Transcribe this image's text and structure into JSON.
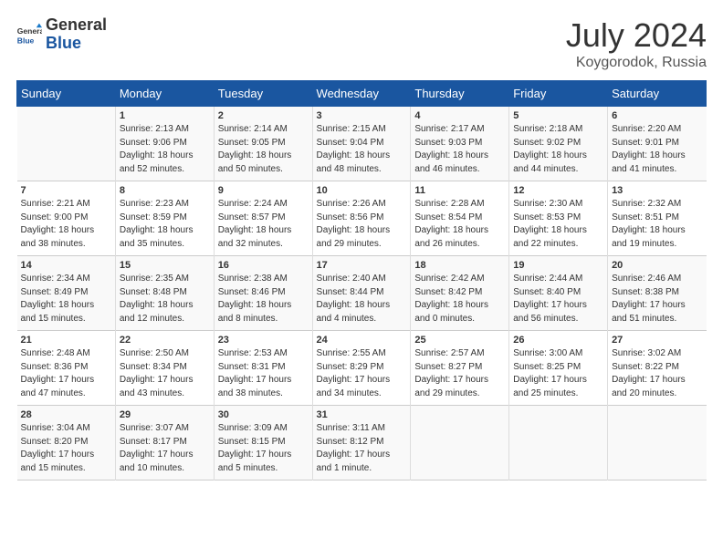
{
  "header": {
    "logo_general": "General",
    "logo_blue": "Blue",
    "month_title": "July 2024",
    "location": "Koygorodok, Russia"
  },
  "weekdays": [
    "Sunday",
    "Monday",
    "Tuesday",
    "Wednesday",
    "Thursday",
    "Friday",
    "Saturday"
  ],
  "weeks": [
    [
      {
        "day": "",
        "info": ""
      },
      {
        "day": "1",
        "info": "Sunrise: 2:13 AM\nSunset: 9:06 PM\nDaylight: 18 hours\nand 52 minutes."
      },
      {
        "day": "2",
        "info": "Sunrise: 2:14 AM\nSunset: 9:05 PM\nDaylight: 18 hours\nand 50 minutes."
      },
      {
        "day": "3",
        "info": "Sunrise: 2:15 AM\nSunset: 9:04 PM\nDaylight: 18 hours\nand 48 minutes."
      },
      {
        "day": "4",
        "info": "Sunrise: 2:17 AM\nSunset: 9:03 PM\nDaylight: 18 hours\nand 46 minutes."
      },
      {
        "day": "5",
        "info": "Sunrise: 2:18 AM\nSunset: 9:02 PM\nDaylight: 18 hours\nand 44 minutes."
      },
      {
        "day": "6",
        "info": "Sunrise: 2:20 AM\nSunset: 9:01 PM\nDaylight: 18 hours\nand 41 minutes."
      }
    ],
    [
      {
        "day": "7",
        "info": "Sunrise: 2:21 AM\nSunset: 9:00 PM\nDaylight: 18 hours\nand 38 minutes."
      },
      {
        "day": "8",
        "info": "Sunrise: 2:23 AM\nSunset: 8:59 PM\nDaylight: 18 hours\nand 35 minutes."
      },
      {
        "day": "9",
        "info": "Sunrise: 2:24 AM\nSunset: 8:57 PM\nDaylight: 18 hours\nand 32 minutes."
      },
      {
        "day": "10",
        "info": "Sunrise: 2:26 AM\nSunset: 8:56 PM\nDaylight: 18 hours\nand 29 minutes."
      },
      {
        "day": "11",
        "info": "Sunrise: 2:28 AM\nSunset: 8:54 PM\nDaylight: 18 hours\nand 26 minutes."
      },
      {
        "day": "12",
        "info": "Sunrise: 2:30 AM\nSunset: 8:53 PM\nDaylight: 18 hours\nand 22 minutes."
      },
      {
        "day": "13",
        "info": "Sunrise: 2:32 AM\nSunset: 8:51 PM\nDaylight: 18 hours\nand 19 minutes."
      }
    ],
    [
      {
        "day": "14",
        "info": "Sunrise: 2:34 AM\nSunset: 8:49 PM\nDaylight: 18 hours\nand 15 minutes."
      },
      {
        "day": "15",
        "info": "Sunrise: 2:35 AM\nSunset: 8:48 PM\nDaylight: 18 hours\nand 12 minutes."
      },
      {
        "day": "16",
        "info": "Sunrise: 2:38 AM\nSunset: 8:46 PM\nDaylight: 18 hours\nand 8 minutes."
      },
      {
        "day": "17",
        "info": "Sunrise: 2:40 AM\nSunset: 8:44 PM\nDaylight: 18 hours\nand 4 minutes."
      },
      {
        "day": "18",
        "info": "Sunrise: 2:42 AM\nSunset: 8:42 PM\nDaylight: 18 hours\nand 0 minutes."
      },
      {
        "day": "19",
        "info": "Sunrise: 2:44 AM\nSunset: 8:40 PM\nDaylight: 17 hours\nand 56 minutes."
      },
      {
        "day": "20",
        "info": "Sunrise: 2:46 AM\nSunset: 8:38 PM\nDaylight: 17 hours\nand 51 minutes."
      }
    ],
    [
      {
        "day": "21",
        "info": "Sunrise: 2:48 AM\nSunset: 8:36 PM\nDaylight: 17 hours\nand 47 minutes."
      },
      {
        "day": "22",
        "info": "Sunrise: 2:50 AM\nSunset: 8:34 PM\nDaylight: 17 hours\nand 43 minutes."
      },
      {
        "day": "23",
        "info": "Sunrise: 2:53 AM\nSunset: 8:31 PM\nDaylight: 17 hours\nand 38 minutes."
      },
      {
        "day": "24",
        "info": "Sunrise: 2:55 AM\nSunset: 8:29 PM\nDaylight: 17 hours\nand 34 minutes."
      },
      {
        "day": "25",
        "info": "Sunrise: 2:57 AM\nSunset: 8:27 PM\nDaylight: 17 hours\nand 29 minutes."
      },
      {
        "day": "26",
        "info": "Sunrise: 3:00 AM\nSunset: 8:25 PM\nDaylight: 17 hours\nand 25 minutes."
      },
      {
        "day": "27",
        "info": "Sunrise: 3:02 AM\nSunset: 8:22 PM\nDaylight: 17 hours\nand 20 minutes."
      }
    ],
    [
      {
        "day": "28",
        "info": "Sunrise: 3:04 AM\nSunset: 8:20 PM\nDaylight: 17 hours\nand 15 minutes."
      },
      {
        "day": "29",
        "info": "Sunrise: 3:07 AM\nSunset: 8:17 PM\nDaylight: 17 hours\nand 10 minutes."
      },
      {
        "day": "30",
        "info": "Sunrise: 3:09 AM\nSunset: 8:15 PM\nDaylight: 17 hours\nand 5 minutes."
      },
      {
        "day": "31",
        "info": "Sunrise: 3:11 AM\nSunset: 8:12 PM\nDaylight: 17 hours\nand 1 minute."
      },
      {
        "day": "",
        "info": ""
      },
      {
        "day": "",
        "info": ""
      },
      {
        "day": "",
        "info": ""
      }
    ]
  ]
}
